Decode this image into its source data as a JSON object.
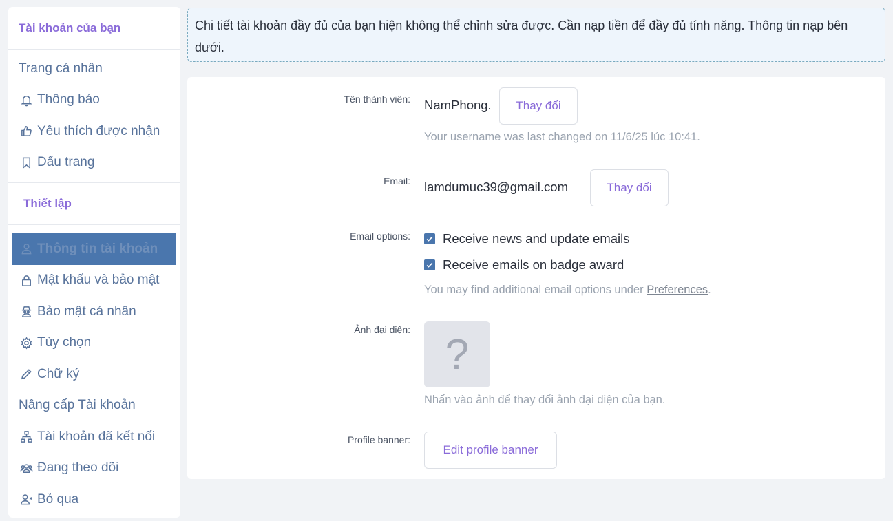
{
  "sidebar": {
    "section_account": "Tài khoản của bạn",
    "account_items": [
      {
        "label": "Trang cá nhân",
        "icon": "none"
      },
      {
        "label": "Thông báo",
        "icon": "bell-icon"
      },
      {
        "label": "Yêu thích được nhận",
        "icon": "thumbs-up-icon"
      },
      {
        "label": "Dấu trang",
        "icon": "bookmark-icon"
      }
    ],
    "section_settings": "Thiết lập",
    "settings_items": [
      {
        "label": "Thông tin tài khoản",
        "icon": "user-icon",
        "active": true
      },
      {
        "label": "Mật khẩu và bảo mật",
        "icon": "lock-icon"
      },
      {
        "label": "Bảo mật cá nhân",
        "icon": "spy-icon"
      },
      {
        "label": "Tùy chọn",
        "icon": "gear-icon"
      },
      {
        "label": "Chữ ký",
        "icon": "pencil-icon"
      },
      {
        "label": "Nâng cấp Tài khoản",
        "icon": "none"
      },
      {
        "label": "Tài khoản đã kết nối",
        "icon": "sitemap-icon"
      },
      {
        "label": "Đang theo dõi",
        "icon": "users-icon"
      },
      {
        "label": "Bỏ qua",
        "icon": "user-x-icon"
      }
    ]
  },
  "notice": {
    "text": "Chi tiết tài khoản đầy đủ của bạn hiện không thể chỉnh sửa được. Cần nạp tiền để đầy đủ tính năng. Thông tin nạp bên dưới."
  },
  "form": {
    "username": {
      "label": "Tên thành viên:",
      "value": "NamPhong.",
      "button": "Thay đổi",
      "hint": "Your username was last changed on 11/6/25 lúc 10:41."
    },
    "email": {
      "label": "Email:",
      "value": "lamdumuc39@gmail.com",
      "button": "Thay đổi"
    },
    "email_options": {
      "label": "Email options:",
      "options": [
        {
          "label": "Receive news and update emails",
          "checked": true
        },
        {
          "label": "Receive emails on badge award",
          "checked": true
        }
      ],
      "hint_prefix": "You may find additional email options under ",
      "hint_link": "Preferences",
      "hint_suffix": "."
    },
    "avatar": {
      "label": "Ảnh đại diện:",
      "placeholder": "?",
      "hint": "Nhấn vào ảnh để thay đổi ảnh đại diện của bạn."
    },
    "banner": {
      "label": "Profile banner:",
      "button": "Edit profile banner"
    }
  },
  "colors": {
    "accent": "#8a6bd9",
    "active_bg": "#4a76ad",
    "sidebar_text": "#58739b",
    "notice_bg": "#eef5fc"
  }
}
